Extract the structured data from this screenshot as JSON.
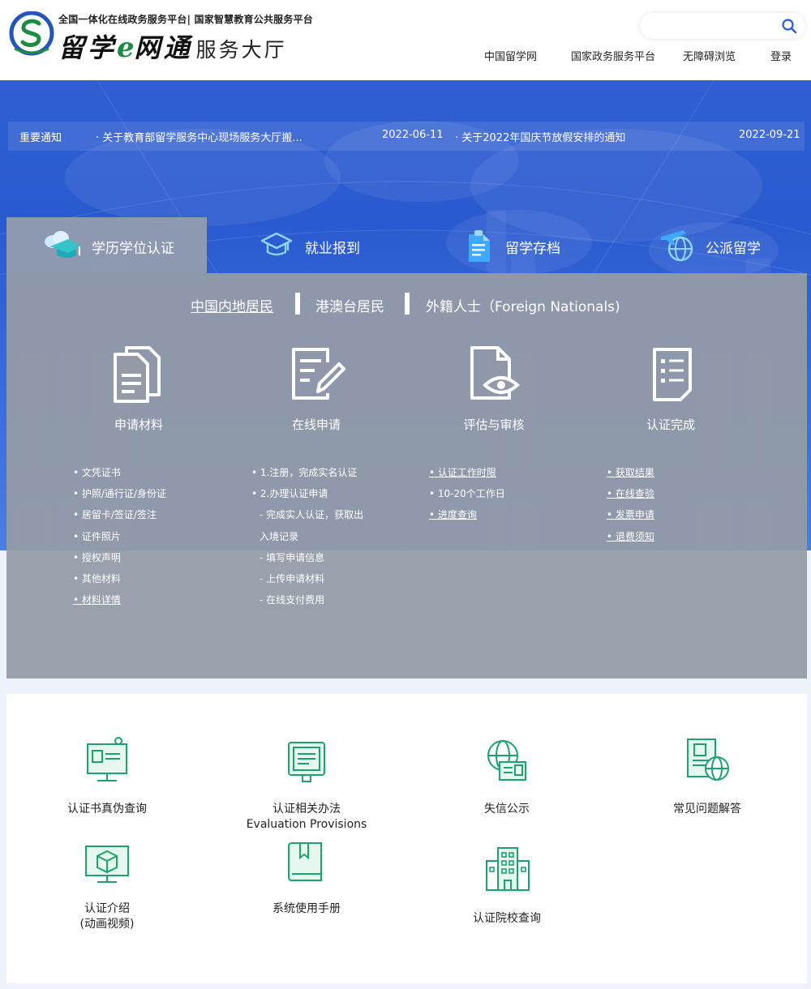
{
  "header": {
    "tagline": "全国一体化在线政务服务平台| 国家智慧教育公共服务平台",
    "title_part1": "留学",
    "title_e": "e",
    "title_part2": "网通",
    "title_hall": "服务大厅",
    "search_placeholder": "",
    "nav": [
      "中国留学网",
      "国家政务服务平台",
      "无障碍浏览",
      "登录"
    ]
  },
  "notice": {
    "label": "重要通知",
    "items": [
      {
        "title": "· 关于教育部留学服务中心现场服务大厅搬...",
        "date": "2022-06-11"
      },
      {
        "title": "· 关于2022年国庆节放假安排的通知",
        "date": "2022-09-21"
      }
    ]
  },
  "tabs": [
    {
      "label": "学历学位认证",
      "icon": "graduation-cap-cloud-icon",
      "active": true
    },
    {
      "label": "就业报到",
      "icon": "graduation-cap-icon",
      "active": false
    },
    {
      "label": "留学存档",
      "icon": "document-archive-icon",
      "active": false
    },
    {
      "label": "公派留学",
      "icon": "plane-globe-icon",
      "active": false
    }
  ],
  "sub_tabs": [
    "中国内地居民",
    "港澳台居民",
    "外籍人士（Foreign Nationals)"
  ],
  "steps": [
    {
      "label": "申请材料",
      "icon": "documents-icon",
      "items": [
        {
          "text": "• 文凭证书",
          "link": false
        },
        {
          "text": "• 护照/通行证/身份证",
          "link": false
        },
        {
          "text": "• 居留卡/签证/签注",
          "link": false
        },
        {
          "text": "• 证件照片",
          "link": false
        },
        {
          "text": "• 授权声明",
          "link": false
        },
        {
          "text": "• 其他材料",
          "link": false
        },
        {
          "text": "• 材料详情",
          "link": true
        }
      ]
    },
    {
      "label": "在线申请",
      "icon": "edit-form-icon",
      "items": [
        {
          "text": "• 1.注册，完成实名认证",
          "link": false
        },
        {
          "text": "• 2.办理认证申请",
          "link": false
        },
        {
          "text": "  - 完成实人认证，获取出",
          "link": false
        },
        {
          "text": "  入境记录",
          "link": false
        },
        {
          "text": "  - 填写申请信息",
          "link": false
        },
        {
          "text": "  - 上传申请材料",
          "link": false
        },
        {
          "text": "  - 在线支付费用",
          "link": false
        }
      ]
    },
    {
      "label": "评估与审核",
      "icon": "document-eye-icon",
      "items": [
        {
          "text": "• 认证工作时限",
          "link": true
        },
        {
          "text": "• 10-20个工作日",
          "link": false
        },
        {
          "text": "• 进度查询",
          "link": true
        }
      ]
    },
    {
      "label": "认证完成",
      "icon": "checklist-icon",
      "items": [
        {
          "text": "• 获取结果",
          "link": true
        },
        {
          "text": "• 在线查验",
          "link": true
        },
        {
          "text": "• 发票申请",
          "link": true
        },
        {
          "text": "• 退费须知",
          "link": true
        }
      ]
    }
  ],
  "services": [
    {
      "label": "认证书真伪查询",
      "sublabel": "",
      "icon": "certificate-monitor-icon"
    },
    {
      "label": "认证相关办法",
      "sublabel": "Evaluation Provisions",
      "icon": "document-scroll-icon"
    },
    {
      "label": "失信公示",
      "sublabel": "",
      "icon": "globe-id-card-icon"
    },
    {
      "label": "常见问题解答",
      "sublabel": "",
      "icon": "document-globe-icon"
    },
    {
      "label": "认证介绍",
      "sublabel": "(动画视频)",
      "icon": "video-cube-icon"
    },
    {
      "label": "系统使用手册",
      "sublabel": "",
      "icon": "manual-book-icon"
    },
    {
      "label": "认证院校查询",
      "sublabel": "",
      "icon": "school-building-icon"
    }
  ],
  "colors": {
    "accent_green": "#1aa36b",
    "hero_blue": "#2f5fd3",
    "panel_gray": "#949ba7",
    "search_icon": "#2a5bd7"
  }
}
